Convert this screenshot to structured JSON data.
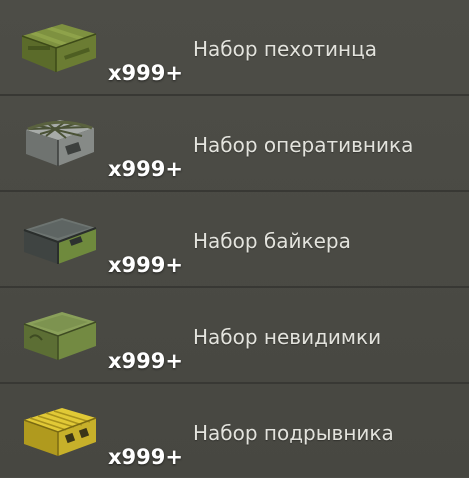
{
  "kits": [
    {
      "name": "Набор пехотинца",
      "quantity": "x999+",
      "icon": "military-green-crate-icon",
      "color": "#6e7f3a"
    },
    {
      "name": "Набор оперативника",
      "quantity": "x999+",
      "icon": "metal-case-with-net-icon",
      "color": "#8a8e8c"
    },
    {
      "name": "Набор байкера",
      "quantity": "x999+",
      "icon": "dark-metal-case-icon",
      "color": "#5a5e5c"
    },
    {
      "name": "Набор невидимки",
      "quantity": "x999+",
      "icon": "green-hard-case-icon",
      "color": "#7a8f4c"
    },
    {
      "name": "Набор подрывника",
      "quantity": "x999+",
      "icon": "yellow-hard-case-icon",
      "color": "#c9b327"
    }
  ]
}
